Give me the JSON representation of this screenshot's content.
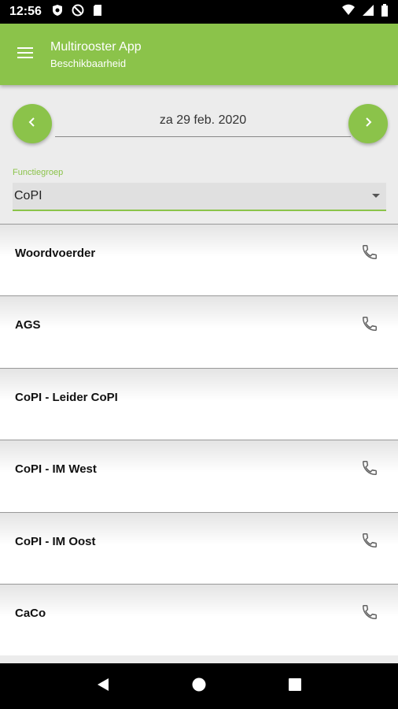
{
  "status_bar": {
    "time": "12:56"
  },
  "app_bar": {
    "title": "Multirooster App",
    "subtitle": "Beschikbaarheid"
  },
  "date_nav": {
    "date": "za 29 feb. 2020"
  },
  "filter": {
    "label": "Functiegroep",
    "value": "CoPI"
  },
  "list": {
    "items": [
      {
        "name": "Woordvoerder",
        "has_phone": true
      },
      {
        "name": "AGS",
        "has_phone": true
      },
      {
        "name": "CoPI - Leider CoPI",
        "has_phone": false
      },
      {
        "name": "CoPI - IM West",
        "has_phone": true
      },
      {
        "name": "CoPI - IM Oost",
        "has_phone": true
      },
      {
        "name": "CaCo",
        "has_phone": true
      }
    ]
  },
  "colors": {
    "accent": "#8bc34a",
    "status_bar": "#000000"
  }
}
